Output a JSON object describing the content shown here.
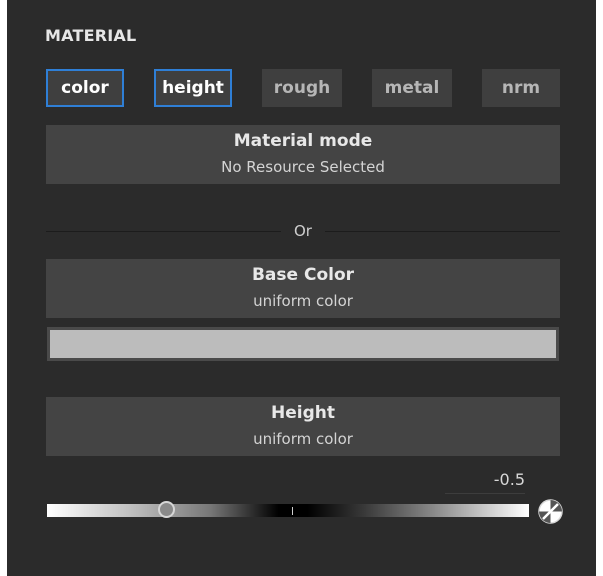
{
  "panel": {
    "header": "MATERIAL"
  },
  "tabs": [
    {
      "label": "color",
      "active": true
    },
    {
      "label": "height",
      "active": true
    },
    {
      "label": "rough",
      "active": false
    },
    {
      "label": "metal",
      "active": false
    },
    {
      "label": "nrm",
      "active": false
    }
  ],
  "material_mode": {
    "title": "Material mode",
    "subtitle": "No Resource Selected"
  },
  "divider": {
    "label": "Or"
  },
  "base_color": {
    "title": "Base Color",
    "subtitle": "uniform color",
    "swatch_color": "#bcbcbc"
  },
  "height": {
    "title": "Height",
    "subtitle": "uniform color",
    "value": "-0.5"
  },
  "colors": {
    "panel_bg": "#2b2b2b",
    "block_bg": "#444444",
    "active_tab_border": "#2f7fd6"
  },
  "icons": {
    "reset": "reset-circle-icon",
    "slider_handle": "circle-handle-icon"
  }
}
